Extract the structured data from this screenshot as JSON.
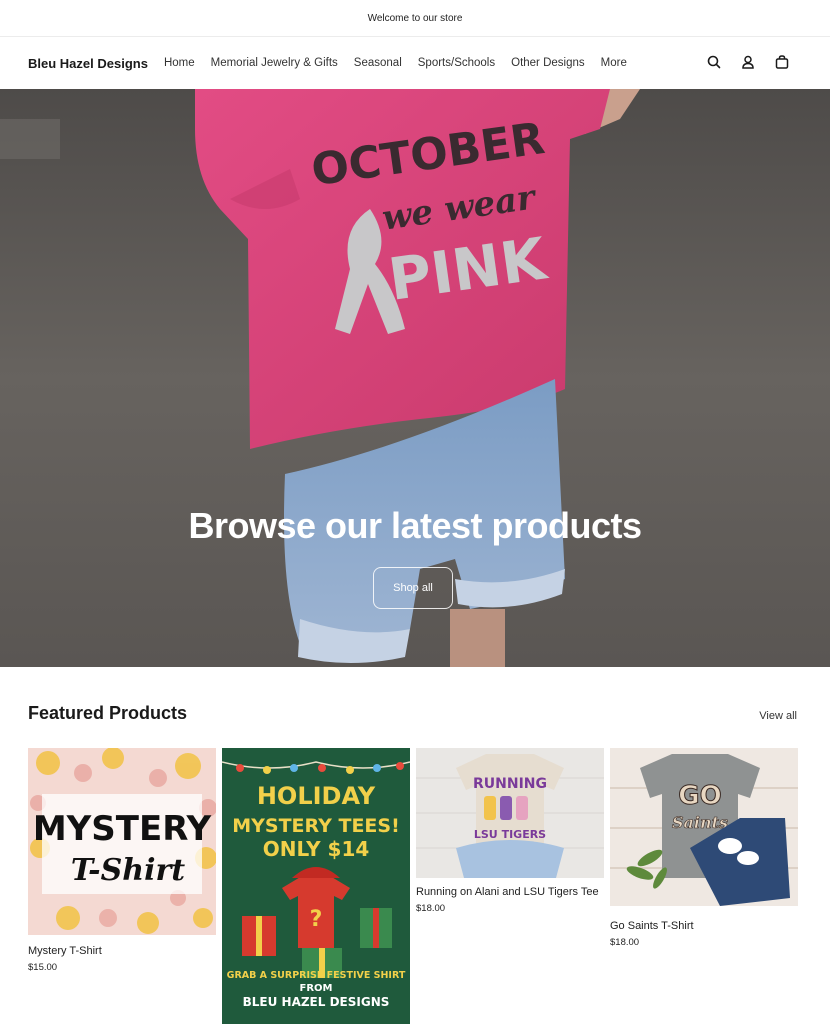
{
  "announcement": "Welcome to our store",
  "brand": "Bleu Hazel Designs",
  "nav": [
    "Home",
    "Memorial Jewelry & Gifts",
    "Seasonal",
    "Sports/Schools",
    "Other Designs",
    "More"
  ],
  "icons": [
    "search-icon",
    "account-icon",
    "cart-icon"
  ],
  "hero": {
    "shirt_line1": "OCTOBER",
    "shirt_line2": "we wear",
    "shirt_line3": "PINK",
    "title": "Browse our latest products",
    "button": "Shop all"
  },
  "featured": {
    "title": "Featured Products",
    "view_all": "View all",
    "products": [
      {
        "name": "Mystery T-Shirt",
        "price": "$15.00",
        "img_line1": "MYSTERY",
        "img_line2": "T-Shirt"
      },
      {
        "name": "",
        "price": "",
        "img_line1": "HOLIDAY",
        "img_line2": "MYSTERY TEES!",
        "img_line3": "ONLY $14",
        "img_line4": "GRAB A SURPRISE FESTIVE SHIRT",
        "img_line5": "FROM",
        "img_line6": "BLEU HAZEL DESIGNS"
      },
      {
        "name": "Running on Alani and LSU Tigers Tee",
        "price": "$18.00",
        "img_line1": "RUNNING",
        "img_line2": "LSU TIGERS"
      },
      {
        "name": "Go Saints T-Shirt",
        "price": "$18.00",
        "img_line1": "GO",
        "img_line2": "Saints"
      }
    ]
  },
  "colors": {
    "accent_pink": "#e0457b",
    "holiday_green": "#1f5a3c",
    "holiday_yellow": "#f2d04a"
  }
}
